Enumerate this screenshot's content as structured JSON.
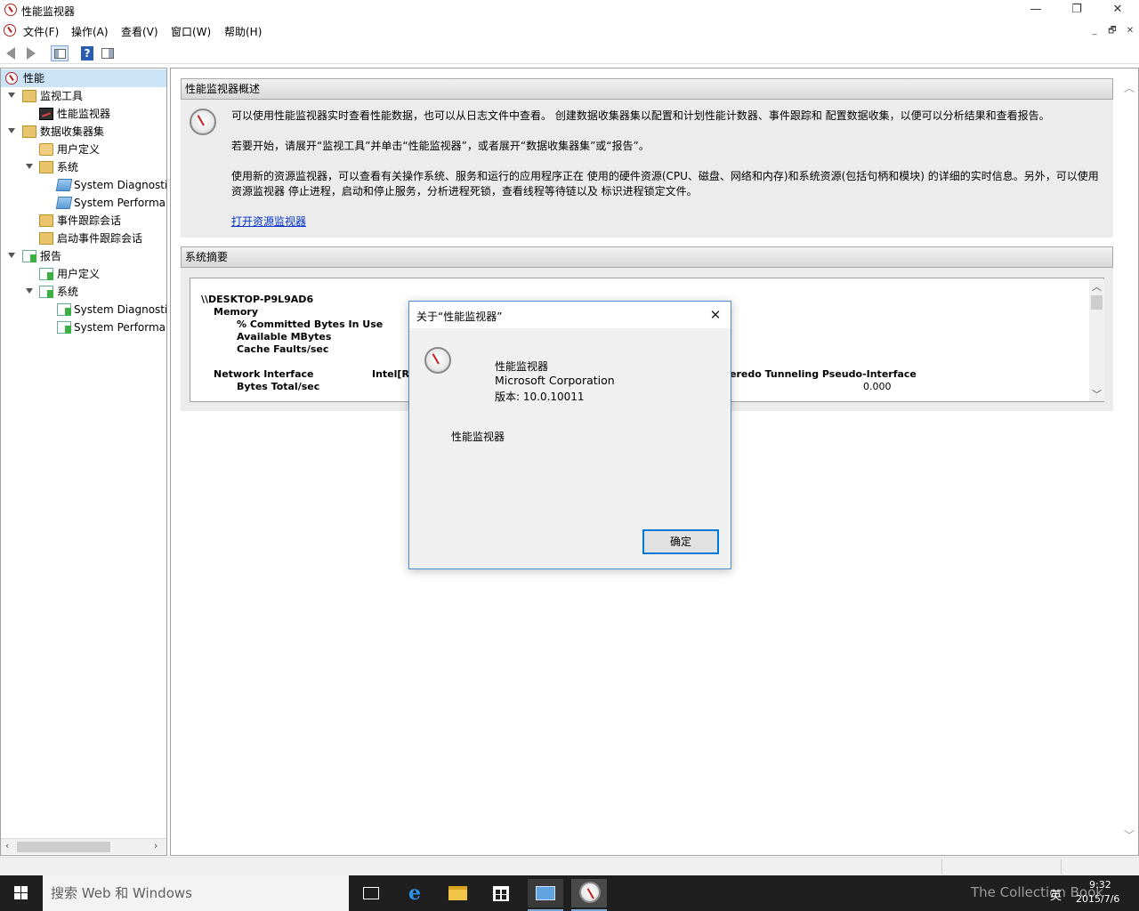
{
  "window": {
    "title": "性能监视器",
    "min_glyph": "—",
    "restore_glyph": "❐",
    "close_glyph": "✕"
  },
  "menu": {
    "items": [
      "文件(F)",
      "操作(A)",
      "查看(V)",
      "窗口(W)",
      "帮助(H)"
    ],
    "mdi_min": "_",
    "mdi_restore": "🗗",
    "mdi_close": "✕"
  },
  "toolbar": {
    "help_glyph": "?"
  },
  "tree": {
    "items": [
      {
        "label": "性能"
      },
      {
        "label": "监视工具"
      },
      {
        "label": "性能监视器"
      },
      {
        "label": "数据收集器集"
      },
      {
        "label": "用户定义"
      },
      {
        "label": "系统"
      },
      {
        "label": "System Diagnostics"
      },
      {
        "label": "System Performance"
      },
      {
        "label": "事件跟踪会话"
      },
      {
        "label": "启动事件跟踪会话"
      },
      {
        "label": "报告"
      },
      {
        "label": "用户定义"
      },
      {
        "label": "系统"
      },
      {
        "label": "System Diagnostics"
      },
      {
        "label": "System Performance"
      }
    ],
    "scroll_left": "‹",
    "scroll_right": "›"
  },
  "overview": {
    "header": "性能监视器概述",
    "para1": "可以使用性能监视器实时查看性能数据，也可以从日志文件中查看。 创建数据收集器集以配置和计划性能计数器、事件跟踪和 配置数据收集，以便可以分析结果和查看报告。",
    "para2": "若要开始，请展开“监视工具”并单击“性能监视器”，或者展开“数据收集器集”或“报告”。",
    "para3a": "使用新的资源监视器，可以查看有关操作系统、服务和运行的应用程序正在 使用的硬件资源(CPU、磁盘、网络和内存)和系统资源(包括句柄和模块) 的详细的实时信息。另外，可以使用",
    "para3b": "资源监视器 停止进程，启动和停止服务，分析进程死锁，查看线程等待链以及 标识进程锁定文件。",
    "link": "打开资源监视器"
  },
  "summary": {
    "header": "系统摘要",
    "host": "\\\\DESKTOP-P9L9AD6",
    "memory": "Memory",
    "counter1": "% Committed Bytes In Use",
    "counter2": "Available MBytes",
    "counter3": "Cache Faults/sec",
    "network": "Network Interface",
    "intel": "Intel[R]",
    "teredo": "eredo Tunneling Pseudo-Interface",
    "bytes_total": "Bytes Total/sec",
    "value": "0.000",
    "scroll_up": "︿",
    "scroll_down": "﹀"
  },
  "main_scroll": {
    "up": "︿",
    "down": "﹀"
  },
  "dialog": {
    "title": "关于“性能监视器”",
    "product": "性能监视器",
    "company": "Microsoft Corporation",
    "version": "版本: 10.0.10011",
    "description": "性能监视器",
    "ok": "确定",
    "close_glyph": "✕"
  },
  "taskbar": {
    "search_placeholder": "搜索 Web 和 Windows",
    "time": "9:32",
    "date": "2015/7/6",
    "ime": "英",
    "watermark": "The Collection Book"
  },
  "colors": {
    "accent": "#0078d7",
    "dialog_border": "#4d8ecf",
    "link": "#0033cc",
    "taskbar": "#1f1f1f"
  }
}
